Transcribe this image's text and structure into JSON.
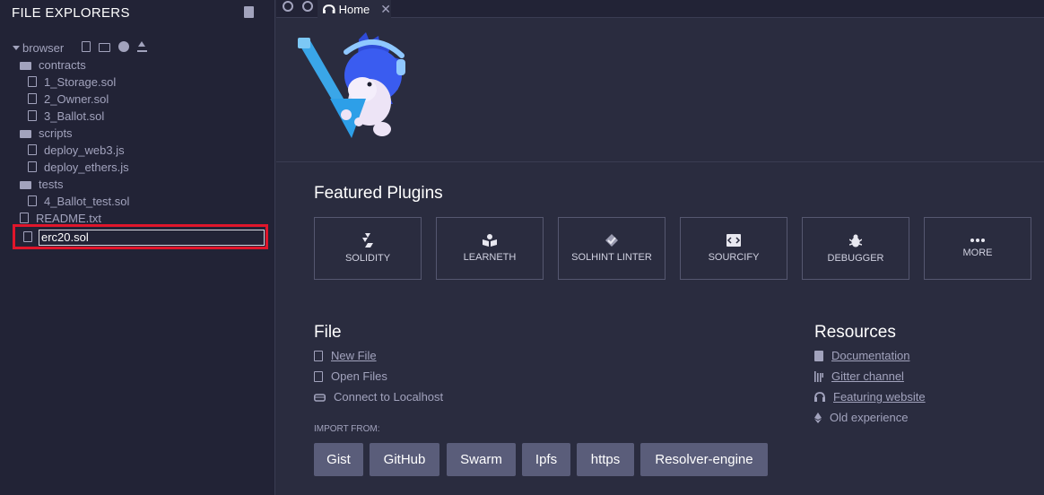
{
  "left_panel": {
    "title": "FILE EXPLORERS",
    "workspace": "browser",
    "tree": [
      {
        "label": "contracts",
        "type": "folder"
      },
      {
        "label": "1_Storage.sol",
        "type": "file"
      },
      {
        "label": "2_Owner.sol",
        "type": "file"
      },
      {
        "label": "3_Ballot.sol",
        "type": "file"
      },
      {
        "label": "scripts",
        "type": "folder"
      },
      {
        "label": "deploy_web3.js",
        "type": "file"
      },
      {
        "label": "deploy_ethers.js",
        "type": "file"
      },
      {
        "label": "tests",
        "type": "folder"
      },
      {
        "label": "4_Ballot_test.sol",
        "type": "file"
      },
      {
        "label": "README.txt",
        "type": "file"
      }
    ],
    "new_file_value": "erc20.sol",
    "highlight_color": "#e0162b"
  },
  "tabs": {
    "home_label": "Home",
    "close_glyph": "✕"
  },
  "main": {
    "featured_title": "Featured Plugins",
    "plugins": [
      {
        "label": "SOLIDITY",
        "icon": "solidity-icon"
      },
      {
        "label": "LEARNETH",
        "icon": "book-icon"
      },
      {
        "label": "SOLHINT LINTER",
        "icon": "solhint-icon"
      },
      {
        "label": "SOURCIFY",
        "icon": "code-icon"
      },
      {
        "label": "DEBUGGER",
        "icon": "bug-icon"
      },
      {
        "label": "MORE",
        "icon": "ellipsis-icon"
      }
    ],
    "file_title": "File",
    "file_links": [
      "New File",
      "Open Files",
      "Connect to Localhost"
    ],
    "resources_title": "Resources",
    "resources_links": [
      "Documentation",
      "Gitter channel",
      "Featuring website",
      "Old experience"
    ],
    "import_label": "IMPORT FROM:",
    "import_buttons": [
      "Gist",
      "GitHub",
      "Swarm",
      "Ipfs",
      "https",
      "Resolver-engine"
    ]
  }
}
